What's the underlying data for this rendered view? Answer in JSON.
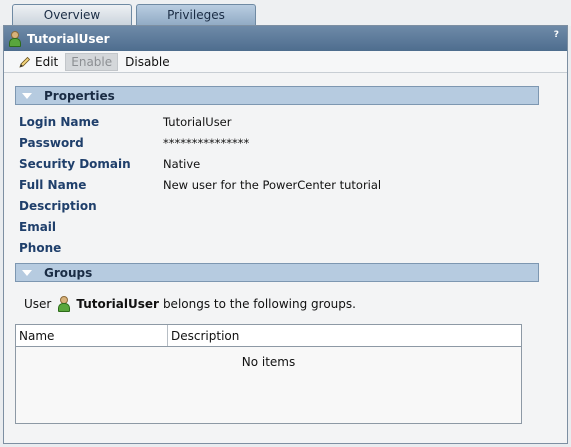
{
  "tabs": [
    {
      "label": "Overview",
      "active": true
    },
    {
      "label": "Privileges",
      "active": false
    }
  ],
  "panel": {
    "title": "TutorialUser",
    "help": "?"
  },
  "toolbar": {
    "edit_label": "Edit",
    "enable_label": "Enable",
    "disable_label": "Disable"
  },
  "properties": {
    "header": "Properties",
    "rows": [
      {
        "label": "Login Name",
        "value": "TutorialUser"
      },
      {
        "label": "Password",
        "value": "***************"
      },
      {
        "label": "Security Domain",
        "value": "Native"
      },
      {
        "label": "Full Name",
        "value": "New user for the PowerCenter tutorial"
      },
      {
        "label": "Description",
        "value": ""
      },
      {
        "label": "Email",
        "value": ""
      },
      {
        "label": "Phone",
        "value": ""
      }
    ]
  },
  "groups": {
    "header": "Groups",
    "prefix": "User",
    "user": "TutorialUser",
    "suffix": "belongs to the following groups.",
    "columns": [
      "Name",
      "Description"
    ],
    "empty_text": "No items"
  },
  "colors": {
    "title_bar": "#5b7a9b",
    "section_header": "#b6cbe0",
    "label_text": "#1f3f6b"
  }
}
